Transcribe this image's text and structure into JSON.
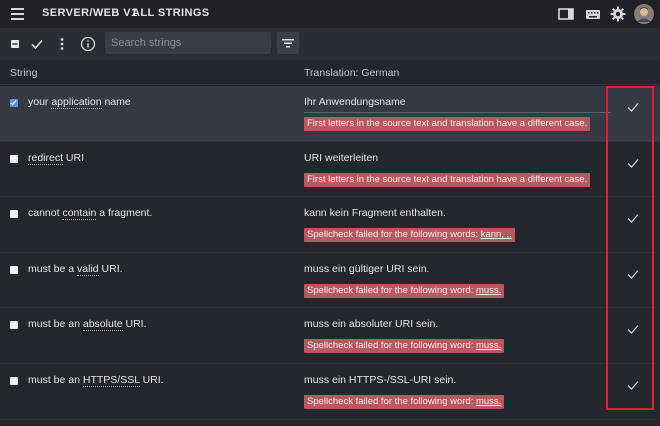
{
  "topbar": {
    "project": "SERVER/WEB V1",
    "view": "ALL STRINGS"
  },
  "toolbar": {
    "search_placeholder": "Search strings"
  },
  "header": {
    "col_string": "String",
    "col_translation": "Translation: German"
  },
  "rows": [
    {
      "selected": true,
      "source_parts": [
        "your ",
        "application",
        " name"
      ],
      "translation": "Ihr Anwendungsname",
      "warning_text": "First letters in the source text and translation have a different case.",
      "warning_words": ""
    },
    {
      "selected": false,
      "source_parts": [
        "",
        "redirect",
        " URI"
      ],
      "translation": "URI weiterleiten",
      "warning_text": "First letters in the source text and translation have a different case.",
      "warning_words": ""
    },
    {
      "selected": false,
      "source_parts": [
        "cannot ",
        "contain",
        " a fragment."
      ],
      "translation": "kann kein Fragment enthalten.",
      "warning_text": "Spellcheck failed for the following words: ",
      "warning_words": "kann, ,."
    },
    {
      "selected": false,
      "source_parts": [
        "must be a ",
        "valid",
        " URI."
      ],
      "translation": "muss ein gültiger URI sein.",
      "warning_text": "Spellcheck failed for the following word: ",
      "warning_words": "muss."
    },
    {
      "selected": false,
      "source_parts": [
        "must be an ",
        "absolute",
        " URI."
      ],
      "translation": "muss ein absoluter URI sein.",
      "warning_text": "Spellcheck failed for the following word: ",
      "warning_words": "muss."
    },
    {
      "selected": false,
      "source_parts": [
        "must be an ",
        "HTTPS/SSL",
        " URI."
      ],
      "translation": "muss ein HTTPS-/SSL-URI sein.",
      "warning_text": "Spellcheck failed for the following word: ",
      "warning_words": "muss."
    }
  ],
  "icons": {
    "menu": "menu-icon",
    "sidebar_toggle": "sidebar-layout-icon",
    "keyboard": "keyboard-icon",
    "settings": "gear-icon",
    "avatar": "avatar",
    "select_all": "indeterminate-checkbox-icon",
    "approve_all": "checkmark-icon",
    "more": "more-vertical-icon",
    "info": "info-icon",
    "filter": "filter-icon",
    "approve": "approve-checkmark-icon"
  },
  "colors": {
    "warning_bg": "#b85860",
    "highlight_box": "#e0202a",
    "selected_checkbox": "#5a8fe8"
  }
}
